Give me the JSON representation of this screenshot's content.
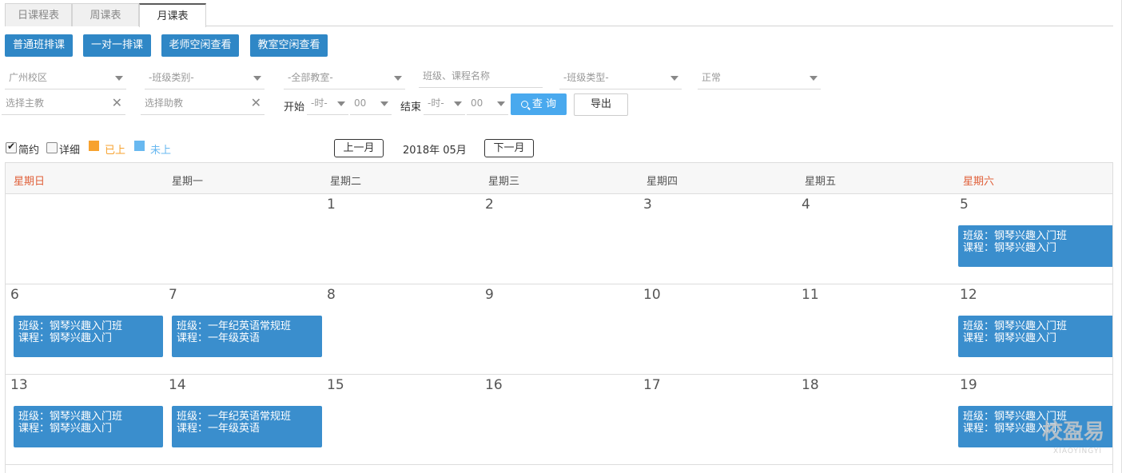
{
  "tabs": [
    "日课程表",
    "周课表",
    "月课表"
  ],
  "actions": [
    "普通班排课",
    "一对一排课",
    "老师空闲查看",
    "教室空闲查看"
  ],
  "filters": {
    "campus": "广州校区",
    "class_category": "-班级类别-",
    "classroom": "-全部教室-",
    "search_placeholder": "班级、课程名称",
    "class_type": "-班级类型-",
    "status": "正常",
    "teacher_placeholder": "选择主教",
    "assistant_placeholder": "选择助教",
    "start_label": "开始",
    "end_label": "结束",
    "hour_placeholder": "-时-",
    "minute_value": "00",
    "query_label": "查 询",
    "export_label": "导出"
  },
  "legend": {
    "brief": "简约",
    "detail": "详细",
    "done": "已上",
    "pending": "未上",
    "done_color": "#f7a22e",
    "pending_color": "#68b8f0"
  },
  "nav": {
    "prev": "上一月",
    "current": "2018年 05月",
    "next": "下一月"
  },
  "weekdays": [
    "星期日",
    "星期一",
    "星期二",
    "星期三",
    "星期四",
    "星期五",
    "星期六"
  ],
  "weeks": [
    {
      "days": [
        "",
        "",
        "1",
        "2",
        "3",
        "4",
        "5"
      ]
    },
    {
      "days": [
        "6",
        "7",
        "8",
        "9",
        "10",
        "11",
        "12"
      ]
    },
    {
      "days": [
        "13",
        "14",
        "15",
        "16",
        "17",
        "18",
        "19"
      ]
    }
  ],
  "events": {
    "piano_class": "班级：钢琴兴趣入门班",
    "piano_course": "课程：钢琴兴趣入门",
    "english_class": "班级：一年纪英语常规班",
    "english_course": "课程：一年级英语"
  },
  "watermark": {
    "main": "校盈易",
    "sub": "XIAOYINGYI"
  }
}
